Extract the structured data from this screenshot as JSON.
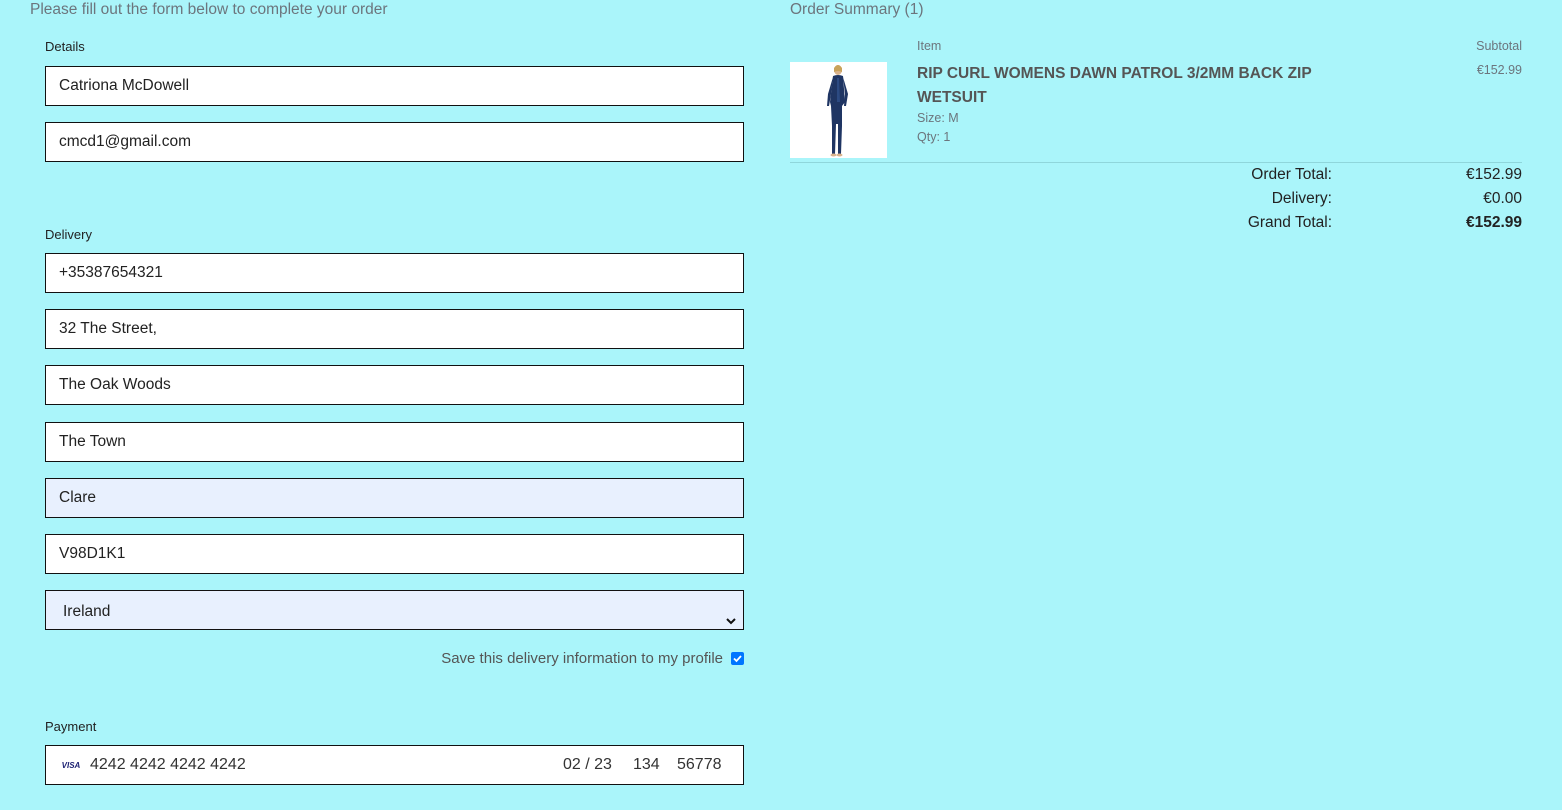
{
  "form": {
    "intro": "Please fill out the form below to complete your order",
    "details_label": "Details",
    "full_name": "Catriona McDowell",
    "email": "cmcd1@gmail.com",
    "delivery_label": "Delivery",
    "phone": "+35387654321",
    "street1": "32 The Street,",
    "street2": "The Oak Woods",
    "town": "The Town",
    "county": "Clare",
    "postcode": "V98D1K1",
    "country": "Ireland",
    "save_info_label": "Save this delivery information to my profile",
    "save_info_checked": true,
    "payment_label": "Payment",
    "card": {
      "brand": "VISA",
      "number": "4242 4242 4242 4242",
      "expiry": "02 / 23",
      "cvc": "134",
      "zip": "56778"
    }
  },
  "summary": {
    "title": "Order Summary (1)",
    "item_header": "Item",
    "subtotal_header": "Subtotal",
    "item": {
      "name": "RIP CURL WOMENS DAWN PATROL 3/2MM BACK ZIP WETSUIT",
      "size": "Size: M",
      "qty": "Qty: 1",
      "price": "€152.99"
    },
    "order_total_label": "Order Total:",
    "order_total": "€152.99",
    "delivery_label": "Delivery:",
    "delivery": "€0.00",
    "grand_total_label": "Grand Total:",
    "grand_total": "€152.99"
  },
  "colors": {
    "background": "#aaf5fa",
    "checkbox": "#0075ff",
    "autofill": "#e8f0fe"
  }
}
